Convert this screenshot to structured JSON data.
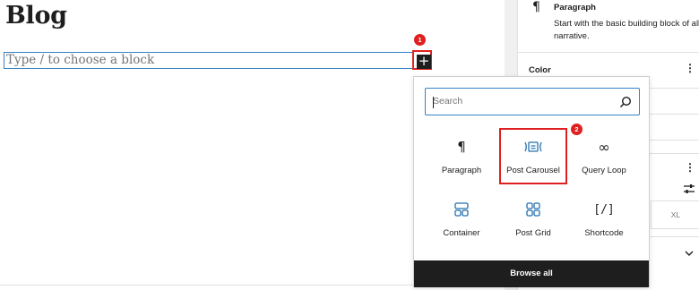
{
  "editor": {
    "title": "Blog",
    "block_placeholder": "Type / to choose a block",
    "inserter_button_symbol": "+"
  },
  "callouts": {
    "step1": "1",
    "step2": "2",
    "color": "#e02020"
  },
  "inserter": {
    "search_placeholder": "Search",
    "blocks": [
      {
        "label": "Paragraph",
        "icon": "paragraph-icon"
      },
      {
        "label": "Post Carousel",
        "icon": "post-carousel-icon"
      },
      {
        "label": "Query Loop",
        "icon": "query-loop-icon"
      },
      {
        "label": "Container",
        "icon": "container-icon"
      },
      {
        "label": "Post Grid",
        "icon": "post-grid-icon"
      },
      {
        "label": "Shortcode",
        "icon": "shortcode-icon"
      }
    ],
    "browse_all_label": "Browse all"
  },
  "sidebar": {
    "block_icon": "¶",
    "block_title": "Paragraph",
    "block_description": "Start with the basic building block of all narrative.",
    "color_heading": "Color",
    "typography_size_xl": "XL"
  },
  "colors": {
    "accent_blue": "#3582c4",
    "block_icon_blue": "#2271b1",
    "dark": "#1e1e1e"
  }
}
